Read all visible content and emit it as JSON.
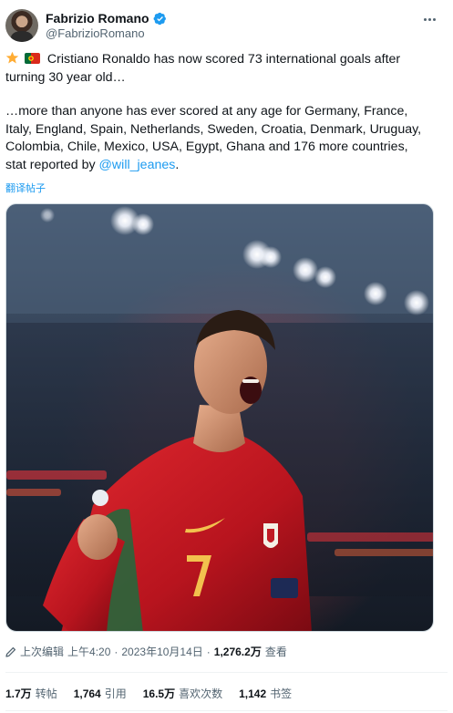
{
  "author": {
    "display_name": "Fabrizio Romano",
    "handle": "@FabrizioRomano",
    "verified": true,
    "avatar_icon": "avatar-photo"
  },
  "tweet": {
    "line1_emojis": [
      "star-emoji",
      "portugal-flag-emoji"
    ],
    "para1": "Cristiano Ronaldo has now scored 73 international goals after turning 30 year old…",
    "para2_line1": "…more than anyone has ever scored at any age for Germany, France,",
    "para2_line2": "Italy, England, Spain, Netherlands, Sweden, Croatia, Denmark, Uruguay,",
    "para2_line3": "Colombia, Chile, Mexico, USA, Egypt, Ghana and 176 more countries,",
    "para2_line4_prefix": "stat reported by ",
    "mention": "@will_jeanes",
    "para2_line4_suffix": ".",
    "translate_label": "翻译帖子"
  },
  "media": {
    "description_icon": "photo-cristiano-ronaldo-celebrating"
  },
  "meta": {
    "edit_label": "上次编辑",
    "time": "上午4:20",
    "separator": "·",
    "date": "2023年10月14日",
    "views_value": "1,276.2万",
    "views_label": "查看"
  },
  "stats": [
    {
      "value": "1.7万",
      "label": "转帖"
    },
    {
      "value": "1,764",
      "label": "引用"
    },
    {
      "value": "16.5万",
      "label": "喜欢次数"
    },
    {
      "value": "1,142",
      "label": "书签"
    }
  ],
  "colors": {
    "link": "#1d9bf0",
    "secondary_text": "#536471",
    "primary_text": "#0f1419"
  }
}
